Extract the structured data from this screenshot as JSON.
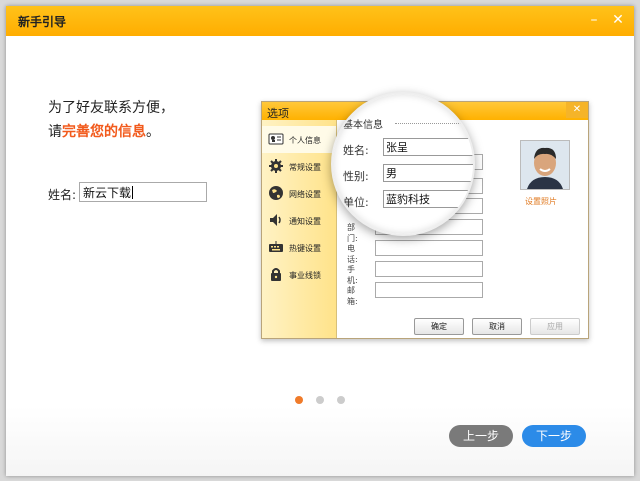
{
  "window": {
    "title": "新手引导",
    "minimize": "–",
    "close": "✕"
  },
  "intro": {
    "line1": "为了好友联系方便，",
    "line2_prefix": "请",
    "line2_highlight": "完善您的信息",
    "line2_suffix": "。"
  },
  "name_field": {
    "label": "姓名:",
    "value": "新云下载"
  },
  "illustration": {
    "title": "选项",
    "close": "✕",
    "sidebar": [
      {
        "label": "个人信息",
        "icon": "id-card-icon"
      },
      {
        "label": "常规设置",
        "icon": "gear-icon"
      },
      {
        "label": "网络设置",
        "icon": "globe-icon"
      },
      {
        "label": "通知设置",
        "icon": "speaker-icon"
      },
      {
        "label": "热键设置",
        "icon": "keyboard-icon"
      },
      {
        "label": "事业线锁",
        "icon": "lock-icon"
      }
    ],
    "form": {
      "rows": [
        {
          "label": "部门:"
        },
        {
          "label": "电话:"
        },
        {
          "label": "手机:"
        },
        {
          "label": "邮箱:"
        }
      ],
      "photo_label": "设置照片"
    },
    "buttons": {
      "ok": "确定",
      "cancel": "取消",
      "apply": "应用"
    },
    "magnifier": {
      "heading": "基本信息",
      "name_label": "姓名:",
      "name_value": "张呈",
      "gender_label": "性别:",
      "gender_value": "男",
      "unit_label": "单位:",
      "unit_value": "蓝豹科技"
    }
  },
  "pagination": {
    "current": 1,
    "total": 3,
    "active_color": "#f07b2a",
    "inactive_color": "#cccccc"
  },
  "nav": {
    "prev": "上一步",
    "next": "下一步"
  },
  "colors": {
    "accent": "#ffb100",
    "highlight": "#f25a1c",
    "next_button": "#2c8be8",
    "prev_button": "#7a7a7a"
  }
}
